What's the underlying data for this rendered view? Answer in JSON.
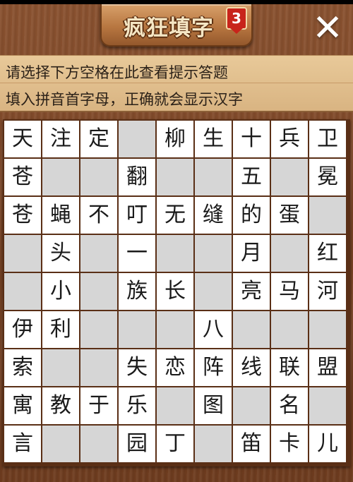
{
  "header": {
    "title": "疯狂填字",
    "level_badge": "3",
    "close_label": "✕"
  },
  "hints": {
    "line1": "请选择下方空格在此查看提示答题",
    "line2": "填入拼音首字母，正确就会显示汉字"
  },
  "grid": [
    [
      "天",
      "注",
      "定",
      "",
      "柳",
      "生",
      "十",
      "兵",
      "卫"
    ],
    [
      "苍",
      "",
      "",
      "翻",
      "",
      "",
      "五",
      "",
      "冕"
    ],
    [
      "苍",
      "蝇",
      "不",
      "叮",
      "无",
      "缝",
      "的",
      "蛋",
      ""
    ],
    [
      "",
      "头",
      "",
      "一",
      "",
      "",
      "月",
      "",
      "红"
    ],
    [
      "",
      "小",
      "",
      "族",
      "长",
      "",
      "亮",
      "马",
      "河"
    ],
    [
      "伊",
      "利",
      "",
      "",
      "",
      "八",
      "",
      "",
      ""
    ],
    [
      "索",
      "",
      "",
      "失",
      "恋",
      "阵",
      "线",
      "联",
      "盟"
    ],
    [
      "寓",
      "教",
      "于",
      "乐",
      "",
      "图",
      "",
      "名",
      ""
    ],
    [
      "言",
      "",
      "",
      "园",
      "丁",
      "",
      "笛",
      "卡",
      "儿"
    ]
  ]
}
